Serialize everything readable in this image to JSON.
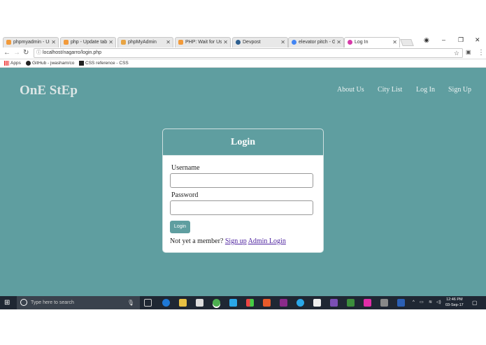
{
  "browser": {
    "tabs": [
      {
        "label": "phpmyadmin - Us",
        "color": "#f29a3a"
      },
      {
        "label": "php - Update tabl",
        "color": "#f29a3a"
      },
      {
        "label": "phpMyAdmin",
        "color": "#e8a443"
      },
      {
        "label": "PHP: Wait for Use",
        "color": "#f29a3a"
      },
      {
        "label": "Devpost",
        "color": "#2d5f8f"
      },
      {
        "label": "elevator pitch - G",
        "color": "#4285f4"
      },
      {
        "label": "Log In",
        "color": "#d63aa8"
      }
    ],
    "url": "localhost/nagarro/login.php",
    "bookmarks": [
      {
        "label": "Apps"
      },
      {
        "label": "GitHub - jwasham/co"
      },
      {
        "label": "CSS reference - CSS"
      }
    ]
  },
  "site": {
    "brand": "OnE StEp",
    "nav": [
      "About Us",
      "City List",
      "Log In",
      "Sign Up"
    ]
  },
  "login": {
    "title": "Login",
    "username_label": "Username",
    "password_label": "Password",
    "button": "Login",
    "member_text": "Not yet a member?",
    "signup_link": "Sign up",
    "admin_link": "Admin Login"
  },
  "taskbar": {
    "search_placeholder": "Type here to search",
    "time": "12:46 PM",
    "date": "03-Sep-17"
  },
  "colors": {
    "page_bg": "#5f9ea0",
    "taskbar_bg": "#1f2733"
  }
}
